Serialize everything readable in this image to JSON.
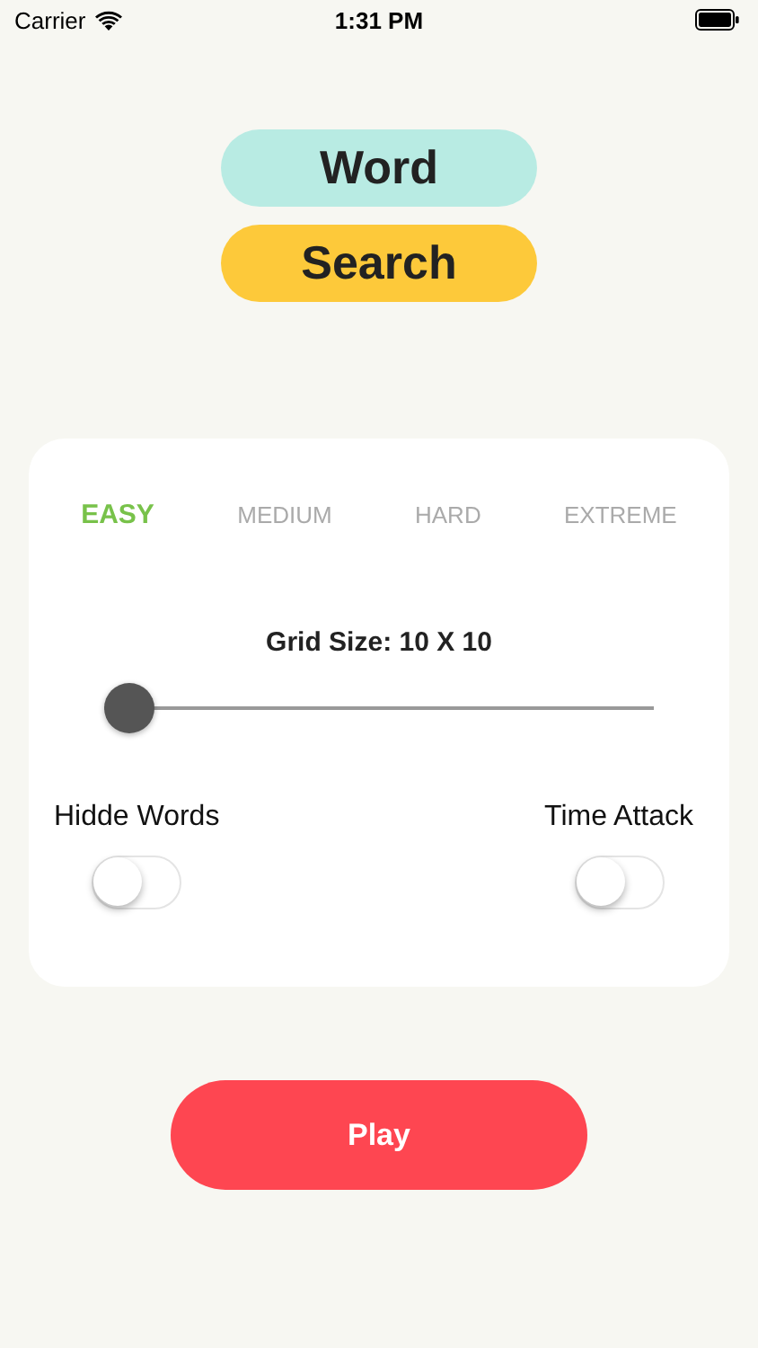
{
  "status_bar": {
    "carrier": "Carrier",
    "time": "1:31 PM"
  },
  "title": [
    "Word",
    "Search"
  ],
  "difficulty_tabs": [
    {
      "label": "EASY",
      "selected": true
    },
    {
      "label": "MEDIUM",
      "selected": false
    },
    {
      "label": "HARD",
      "selected": false
    },
    {
      "label": "EXTREME",
      "selected": false
    }
  ],
  "grid_size": {
    "label": "Grid Size: 10 X 10",
    "level": 0
  },
  "toggles": [
    {
      "label": "Hidde Words",
      "on": false
    },
    {
      "label": "Time Attack",
      "on": false
    }
  ],
  "play_button": "Play"
}
